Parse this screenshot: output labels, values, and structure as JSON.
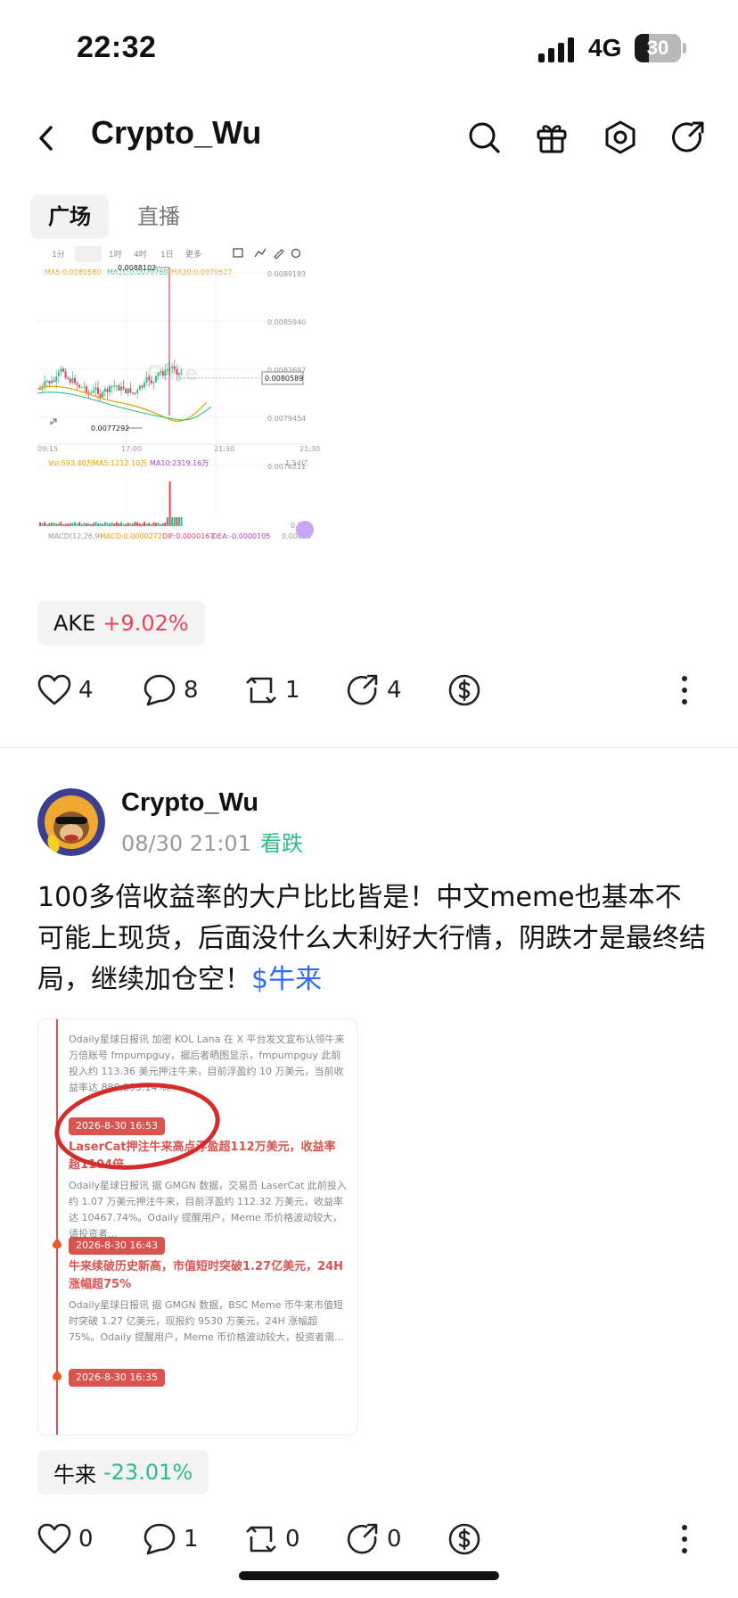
{
  "status": {
    "time": "22:32",
    "network": "4G",
    "battery": "30",
    "battery_level": 0.3
  },
  "nav": {
    "title": "Crypto_Wu",
    "icons": [
      "back-icon",
      "search-icon",
      "gift-icon",
      "settings-icon",
      "share-icon"
    ]
  },
  "tabs": [
    {
      "label": "广场",
      "active": true
    },
    {
      "label": "直播",
      "active": false
    }
  ],
  "chart": {
    "timeframes": [
      "1分",
      "15分",
      "1时",
      "4时",
      "1日",
      "更多"
    ],
    "ma": {
      "ma5": "MA5:0.0080580",
      "ma10": "MA10:0.0079769",
      "ma30": "MA30:0.0079527"
    },
    "price_ticks": [
      "0.0089183",
      "0.0085940",
      "0.0082697",
      "0.0079454",
      "0.0076211"
    ],
    "high_label": "0.0088102",
    "low_label": "0.0077292",
    "current_price": "0.0080589",
    "time_ticks": [
      "09:15",
      "17:00",
      "21:30",
      "21:30"
    ],
    "vol": {
      "vol": "Vol:593.40万",
      "ma5": "MA5:1212.10万",
      "ma10": "MA10:2319.16万",
      "max": "1.54亿",
      "zero": "0.00"
    },
    "macd": {
      "macd": "MACD(12,26,9)",
      "val": "MACD:0.0000272",
      "dif": "DIF:0.0000167",
      "dea": "DEA:-0.0000105",
      "right": "0.00038"
    },
    "watermark": "Gate"
  },
  "post1": {
    "token": {
      "name": "AKE",
      "change": "+9.02%"
    },
    "actions": {
      "likes": "4",
      "comments": "8",
      "reposts": "1",
      "shares": "4"
    }
  },
  "post2": {
    "author": "Crypto_Wu",
    "time": "08/30 21:01",
    "sentiment": "看跌",
    "text": "100多倍收益率的大户比比皆是！中文meme也基本不可能上现货，后面没什么大利好大行情，阴跌才是最终结局，继续加仓空！",
    "tag": "$牛来",
    "news": [
      {
        "time": "",
        "headline": "",
        "body": "Odaily星球日报讯 加密 KOL Lana 在 X 平台发文宣布认领牛来万倍账号 fmpumpguy，据后者晒图显示，fmpumpguy 此前投入约 113.36 美元押注牛来，目前浮盈约 10 万美元，当前收益率达 888,295.14%。"
      },
      {
        "time": "2026-8-30 16:53",
        "headline": "LaserCat押注牛来高点浮盈超112万美元，收益率超1104倍",
        "body": "Odaily星球日报讯 据 GMGN 数据，交易员 LaserCat 此前投入约 1.07 万美元押注牛来，目前浮盈约 112.32 万美元，收益率达 10467.74%。Odaily 提醒用户，Meme 币价格波动较大，请投资者..."
      },
      {
        "time": "2026-8-30 16:43",
        "headline": "牛来续破历史新高，市值短时突破1.27亿美元，24H涨幅超75%",
        "body": "Odaily星球日报讯 据 GMGN 数据，BSC Meme 币牛来市值短时突破 1.27 亿美元，现报约 9530 万美元，24H 涨幅超 75%。Odaily 提醒用户，Meme 币价格波动较大，投资者需..."
      },
      {
        "time": "2026-8-30 16:35",
        "headline": "",
        "body": ""
      }
    ],
    "token": {
      "name": "牛来",
      "change": "-23.01%"
    },
    "actions": {
      "likes": "0",
      "comments": "1",
      "reposts": "0",
      "shares": "0"
    }
  },
  "colors": {
    "up": "#e8435a",
    "down": "#2ebd85",
    "link": "#2e6bff",
    "news_red": "#d9534f"
  }
}
